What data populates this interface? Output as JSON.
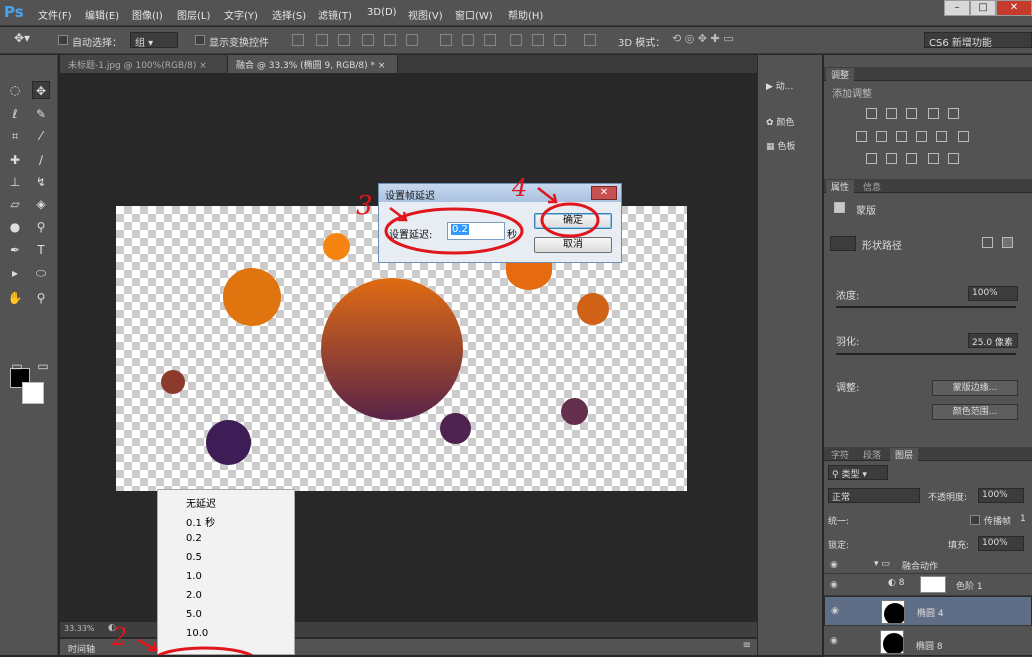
{
  "app": {
    "logo": "Ps"
  },
  "menu": [
    "文件(F)",
    "编辑(E)",
    "图像(I)",
    "图层(L)",
    "文字(Y)",
    "选择(S)",
    "滤镜(T)",
    "3D(D)",
    "视图(V)",
    "窗口(W)",
    "帮助(H)"
  ],
  "window_controls": {
    "minimize": "–",
    "restore": "□",
    "close": "✕"
  },
  "options": {
    "auto_select_label": "自动选择：",
    "auto_select_value": "组",
    "show_transform_label": "显示变换控件",
    "mode_3d_label": "3D 模式：",
    "workspace": "CS6 新增功能"
  },
  "tabs": [
    {
      "label": "未标题-1.jpg @ 100%(RGB/8)",
      "close": "×"
    },
    {
      "label": "融合 @ 33.3% (椭圆 9, RGB/8) *",
      "close": "×"
    }
  ],
  "status": {
    "zoom": "33.33%"
  },
  "timeline": {
    "label": "时间轴"
  },
  "frame_delay_menu": {
    "items": [
      "无延迟",
      "0.1 秒",
      "0.2",
      "0.5",
      "1.0",
      "2.0",
      "5.0",
      "10.0"
    ]
  },
  "dialog": {
    "title": "设置帧延迟",
    "close": "✕",
    "label": "设置延迟:",
    "value": "0.2",
    "unit": "秒",
    "ok": "确定",
    "cancel": "取消"
  },
  "annotations": {
    "n2": "2",
    "n3": "3",
    "n4": "4"
  },
  "dock": [
    {
      "icon": "play-icon",
      "label": "动..."
    },
    {
      "icon": "palette-icon",
      "label": "颜色"
    },
    {
      "icon": "swatches-icon",
      "label": "色板"
    }
  ],
  "adjustments": {
    "tab": "调整",
    "title": "添加调整"
  },
  "properties": {
    "tabs": [
      "属性",
      "信息"
    ],
    "mask_label": "蒙版",
    "shape_path": "形状路径",
    "density_label": "浓度:",
    "density_value": "100%",
    "feather_label": "羽化:",
    "feather_value": "25.0 像素",
    "refine_label": "调整:",
    "mask_edge": "蒙版边缘...",
    "color_range": "颜色范围..."
  },
  "layers": {
    "tabs": [
      "字符",
      "段落",
      "图层"
    ],
    "filter_kind": "类型",
    "blend_mode": "正常",
    "opacity_label": "不透明度:",
    "opacity_value": "100%",
    "unify_label": "统一:",
    "propagate_label": "传播帧",
    "propagate_value": "1",
    "lock_label": "锁定:",
    "fill_label": "填充:",
    "fill_value": "100%",
    "items": [
      {
        "name": "融合动作"
      },
      {
        "name": "色阶 1"
      },
      {
        "name": "椭圆 4"
      },
      {
        "name": "椭圆 8"
      }
    ]
  },
  "colors": {
    "annotation": "#e0161c",
    "canvas_circles": [
      "#f08a10",
      "#e2740f",
      "#e66a10",
      "#d96a1a",
      "#8b3a2d",
      "#b05a2a",
      "#4e2350",
      "#5a2a4e",
      "#65304e",
      "#3e1c55"
    ]
  }
}
